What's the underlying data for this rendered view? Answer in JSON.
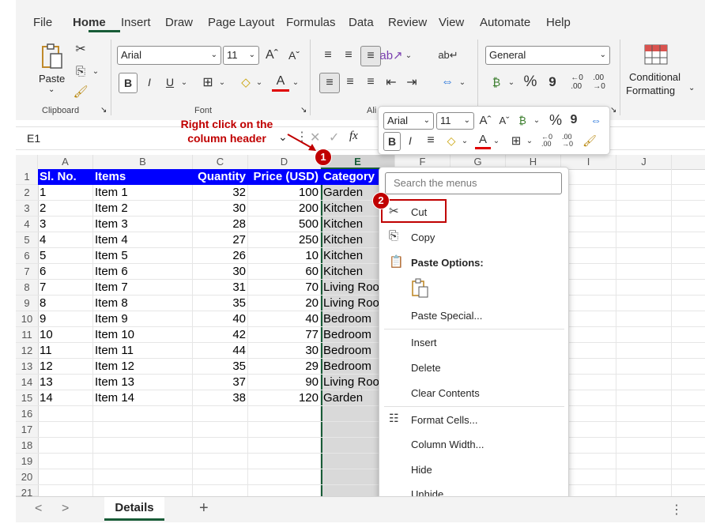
{
  "ribbon": {
    "tabs": [
      "File",
      "Home",
      "Insert",
      "Draw",
      "Page Layout",
      "Formulas",
      "Data",
      "Review",
      "View",
      "Automate",
      "Help"
    ],
    "paste_label": "Paste",
    "font_name": "Arial",
    "font_size": "11",
    "number_format": "General",
    "conditional_line1": "Conditional",
    "conditional_line2": "Formatting",
    "groups": {
      "clipboard": "Clipboard",
      "font": "Font",
      "alignment": "Ali"
    },
    "percent": "%",
    "comma": "9",
    "bold": "B",
    "italic": "I",
    "underline": "U",
    "font_color_letter": "A"
  },
  "formula_bar": {
    "name_box": "E1",
    "fx": "fx"
  },
  "annotation": {
    "step1_text_line1": "Right click on the",
    "step1_text_line2": "column header",
    "badge1": "1",
    "badge2": "2"
  },
  "columns": [
    "A",
    "B",
    "C",
    "D",
    "E",
    "F",
    "G",
    "H",
    "I",
    "J"
  ],
  "rows": [
    "1",
    "2",
    "3",
    "4",
    "5",
    "6",
    "7",
    "8",
    "9",
    "10",
    "11",
    "12",
    "13",
    "14",
    "15",
    "16",
    "17",
    "18",
    "19",
    "20",
    "21"
  ],
  "table": {
    "headers": [
      "Sl. No.",
      "Items",
      "Quantity",
      "Price (USD)",
      "Category"
    ],
    "data": [
      [
        "1",
        "Item 1",
        "32",
        "100",
        "Garden"
      ],
      [
        "2",
        "Item 2",
        "30",
        "200",
        "Kitchen"
      ],
      [
        "3",
        "Item 3",
        "28",
        "500",
        "Kitchen"
      ],
      [
        "4",
        "Item 4",
        "27",
        "250",
        "Kitchen"
      ],
      [
        "5",
        "Item 5",
        "26",
        "10",
        "Kitchen"
      ],
      [
        "6",
        "Item 6",
        "30",
        "60",
        "Kitchen"
      ],
      [
        "7",
        "Item 7",
        "31",
        "70",
        "Living Roo"
      ],
      [
        "8",
        "Item 8",
        "35",
        "20",
        "Living Roo"
      ],
      [
        "9",
        "Item 9",
        "40",
        "40",
        "Bedroom"
      ],
      [
        "10",
        "Item 10",
        "42",
        "77",
        "Bedroom"
      ],
      [
        "11",
        "Item 11",
        "44",
        "30",
        "Bedroom"
      ],
      [
        "12",
        "Item 12",
        "35",
        "29",
        "Bedroom"
      ],
      [
        "13",
        "Item 13",
        "37",
        "90",
        "Living Roo"
      ],
      [
        "14",
        "Item 14",
        "38",
        "120",
        "Garden"
      ]
    ]
  },
  "mini_toolbar": {
    "font_name": "Arial",
    "font_size": "11",
    "percent": "%",
    "comma": "9",
    "bold": "B",
    "italic": "I",
    "font_color_letter": "A"
  },
  "context_menu": {
    "search_placeholder": "Search the menus",
    "cut": "Cut",
    "copy": "Copy",
    "paste_options": "Paste Options:",
    "paste_special": "Paste Special...",
    "insert": "Insert",
    "delete": "Delete",
    "clear_contents": "Clear Contents",
    "format_cells": "Format Cells...",
    "column_width": "Column Width...",
    "hide": "Hide",
    "unhide": "Unhide"
  },
  "sheets": {
    "active": "Details",
    "add": "+",
    "prev": "<",
    "next": ">",
    "more": "⋮"
  },
  "colors": {
    "header_fill": "#0000ff",
    "selection": "#d9d9d9",
    "annotation_red": "#c00000",
    "excel_green": "#185c37"
  }
}
